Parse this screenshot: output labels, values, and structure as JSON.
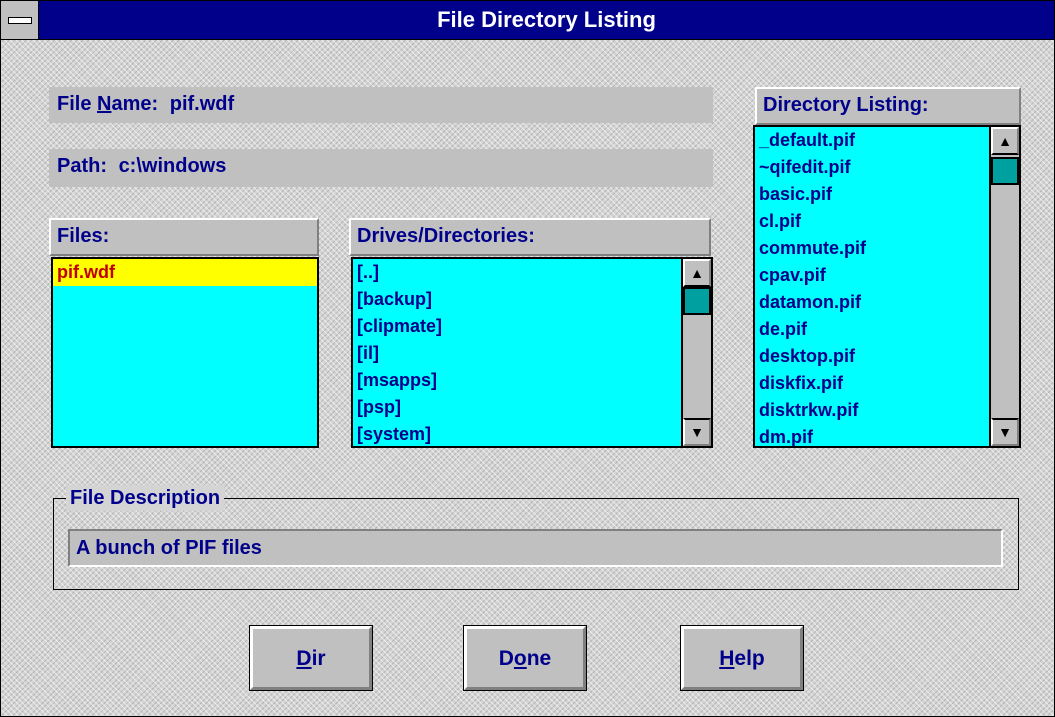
{
  "window": {
    "title": "File Directory Listing",
    "colors": {
      "titlebar": "#00008b",
      "list_bg": "#00ffff",
      "text": "#00008b",
      "selection": "#ffff00",
      "selection_text": "#c00000"
    }
  },
  "file_name": {
    "label": "File Name:",
    "value": "pif.wdf"
  },
  "path": {
    "label": "Path:",
    "value": "c:\\windows"
  },
  "files": {
    "header": "Files:",
    "items": [
      "pif.wdf"
    ],
    "selected_index": 0
  },
  "drives": {
    "header": "Drives/Directories:",
    "items": [
      "[..]",
      "[backup]",
      "[clipmate]",
      "[il]",
      "[msapps]",
      "[psp]",
      "[system]"
    ]
  },
  "directory": {
    "header": "Directory Listing:",
    "items": [
      "_default.pif",
      "~qifedit.pif",
      "basic.pif",
      "cl.pif",
      "commute.pif",
      "cpav.pif",
      "datamon.pif",
      "de.pif",
      "desktop.pif",
      "diskfix.pif",
      "disktrkw.pif",
      "dm.pif"
    ]
  },
  "description": {
    "label": "File Description",
    "value": "A bunch of PIF files"
  },
  "buttons": {
    "dir": {
      "mnemonic": "D",
      "rest": "ir"
    },
    "done": {
      "pre": "D",
      "mnemonic": "o",
      "rest": "ne"
    },
    "help": {
      "mnemonic": "H",
      "rest": "elp"
    }
  },
  "icons": {
    "scroll_up": "up-arrow-icon",
    "scroll_down": "down-arrow-icon",
    "system_menu": "system-menu-icon"
  }
}
